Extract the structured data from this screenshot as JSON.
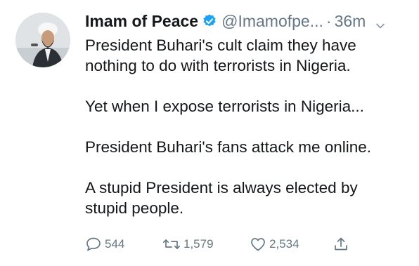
{
  "tweet": {
    "author": {
      "display_name": "Imam of Peace",
      "handle": "@Imamofpe...",
      "verified": true
    },
    "separator": "·",
    "time": "36m",
    "paragraphs": [
      "President Buhari's cult claim they have nothing to do with terrorists in Nigeria.",
      "Yet when I expose terrorists in Nigeria...",
      "President Buhari's fans attack me online.",
      "A stupid President is always elected by stupid people."
    ],
    "stats": {
      "replies": "544",
      "retweets": "1,579",
      "likes": "2,534"
    }
  },
  "icons": {
    "verified": "verified-badge-icon",
    "caret": "chevron-down-icon",
    "reply": "reply-icon",
    "retweet": "retweet-icon",
    "like": "heart-icon",
    "share": "share-icon"
  },
  "colors": {
    "text": "#14171a",
    "muted": "#657786",
    "verified": "#1da1f2"
  }
}
